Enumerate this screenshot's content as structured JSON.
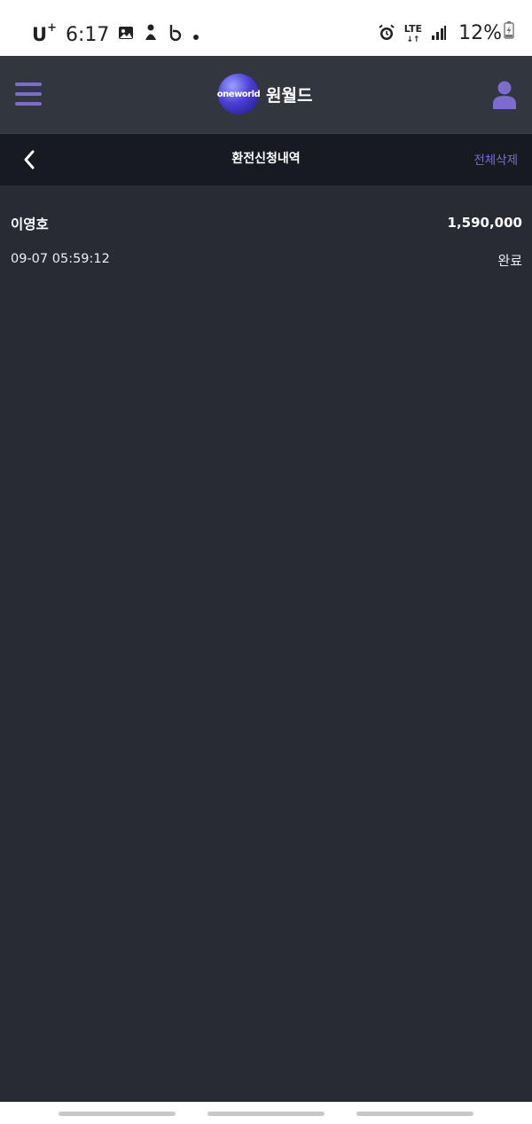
{
  "status_bar": {
    "carrier": "U",
    "carrier_sup": "+",
    "time": "6:17",
    "network": "LTE",
    "battery": "12%"
  },
  "header": {
    "logo_badge": "oneworld",
    "logo_text": "원월드",
    "accent_color": "#7d6bd0"
  },
  "sub_header": {
    "title": "환전신청내역",
    "delete_all_label": "전체삭제"
  },
  "records": [
    {
      "name": "이영호",
      "amount": "1,590,000",
      "datetime": "09-07 05:59:12",
      "status": "완료"
    }
  ],
  "icons": {
    "menu": "hamburger-icon",
    "profile": "user-icon",
    "back": "chevron-left-icon"
  }
}
